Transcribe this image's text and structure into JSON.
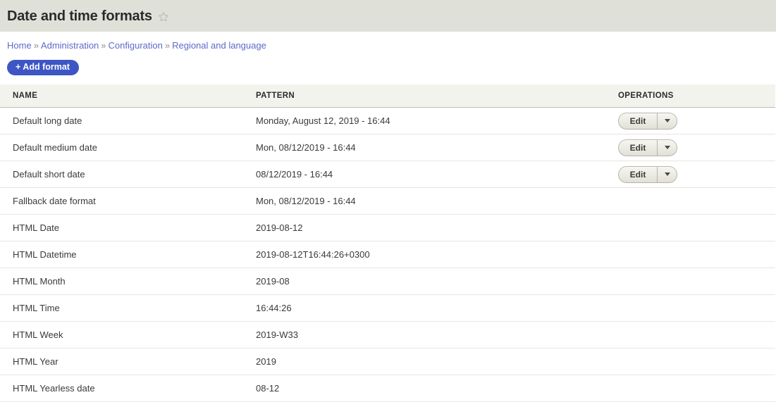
{
  "header": {
    "title": "Date and time formats",
    "star_icon": "star-outline-icon"
  },
  "breadcrumb": {
    "separator": "»",
    "items": [
      {
        "label": "Home"
      },
      {
        "label": "Administration"
      },
      {
        "label": "Configuration"
      },
      {
        "label": "Regional and language"
      }
    ]
  },
  "actions": {
    "add_format_label": "+ Add format"
  },
  "table": {
    "columns": [
      "NAME",
      "PATTERN",
      "OPERATIONS"
    ],
    "operation_label": "Edit",
    "toggle_icon": "chevron-down-icon",
    "rows": [
      {
        "name": "Default long date",
        "pattern": "Monday, August 12, 2019 - 16:44",
        "has_operations": true
      },
      {
        "name": "Default medium date",
        "pattern": "Mon, 08/12/2019 - 16:44",
        "has_operations": true
      },
      {
        "name": "Default short date",
        "pattern": "08/12/2019 - 16:44",
        "has_operations": true
      },
      {
        "name": "Fallback date format",
        "pattern": "Mon, 08/12/2019 - 16:44",
        "has_operations": false
      },
      {
        "name": "HTML Date",
        "pattern": "2019-08-12",
        "has_operations": false
      },
      {
        "name": "HTML Datetime",
        "pattern": "2019-08-12T16:44:26+0300",
        "has_operations": false
      },
      {
        "name": "HTML Month",
        "pattern": "2019-08",
        "has_operations": false
      },
      {
        "name": "HTML Time",
        "pattern": "16:44:26",
        "has_operations": false
      },
      {
        "name": "HTML Week",
        "pattern": "2019-W33",
        "has_operations": false
      },
      {
        "name": "HTML Year",
        "pattern": "2019",
        "has_operations": false
      },
      {
        "name": "HTML Yearless date",
        "pattern": "08-12",
        "has_operations": false
      }
    ]
  },
  "colors": {
    "header_band": "#dfe1d9",
    "accent_button": "#3d56c4",
    "link": "#5c6ac9",
    "table_head_bg": "#f3f3ee",
    "row_border": "#e8e6e1"
  }
}
